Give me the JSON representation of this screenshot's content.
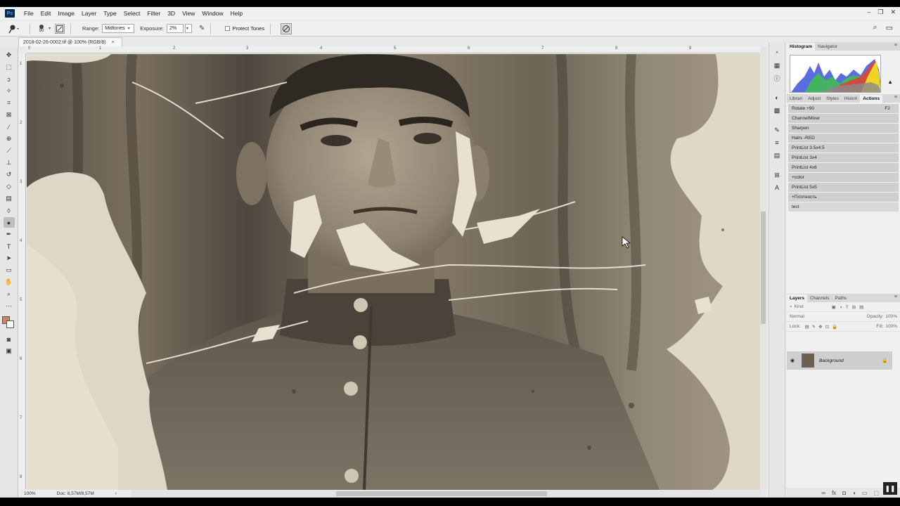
{
  "menu": {
    "logo": "Ps",
    "items": [
      "File",
      "Edit",
      "Image",
      "Layer",
      "Type",
      "Select",
      "Filter",
      "3D",
      "View",
      "Window",
      "Help"
    ],
    "window_controls": [
      "–",
      "❐",
      "✕"
    ]
  },
  "options": {
    "brush_size": "90",
    "range_label": "Range:",
    "range_value": "Midtones",
    "exposure_label": "Exposure:",
    "exposure_value": "2%",
    "protect_tones_label": "Protect Tones"
  },
  "document": {
    "tab_title": "2018-02-26-0002.tif @ 100% (RGB/8)",
    "close": "×"
  },
  "ruler": {
    "top": [
      "0",
      "1",
      "2",
      "3",
      "4",
      "5",
      "6",
      "7",
      "8",
      "9"
    ],
    "left": [
      "1",
      "2",
      "3",
      "4",
      "5",
      "6",
      "7",
      "8"
    ]
  },
  "status": {
    "zoom": "100%",
    "doc": "Doc: 8,57M/8,57M",
    "arrow": "›"
  },
  "panels": {
    "top_tabs": [
      "Histogram",
      "Navigator"
    ],
    "mid_tabs": [
      "Librari",
      "Adjust",
      "Styles",
      "Histori",
      "Actions"
    ],
    "actions": [
      {
        "name": "Rotate +90",
        "key": "F2"
      },
      {
        "name": "ChannelMixer",
        "key": ""
      },
      {
        "name": "Sharpen",
        "key": ""
      },
      {
        "name": "Hairs -RED",
        "key": ""
      },
      {
        "name": "PrintList 3.5x4.5",
        "key": ""
      },
      {
        "name": "PrintList 3x4",
        "key": ""
      },
      {
        "name": "PrintList 4x6",
        "key": ""
      },
      {
        "name": "+color",
        "key": ""
      },
      {
        "name": "PrintList 5x5",
        "key": ""
      },
      {
        "name": "+Плотность",
        "key": ""
      },
      {
        "name": "test",
        "key": ""
      }
    ],
    "layer_tabs": [
      "Layers",
      "Channels",
      "Paths"
    ],
    "kind_label": "Kind",
    "blend_mode": "Normal",
    "opacity_label": "Opacity:",
    "opacity_value": "100%",
    "lock_label": "Lock:",
    "fill_label": "Fill:",
    "fill_value": "100%",
    "layer_name": "Background",
    "footer_icons": [
      "∞",
      "fx",
      "◘",
      "◑",
      "▭",
      "⬚",
      "🗑"
    ]
  },
  "colors": {
    "foreground": "#c28a62",
    "background": "#ffffff",
    "accent": "#31a8ff"
  }
}
